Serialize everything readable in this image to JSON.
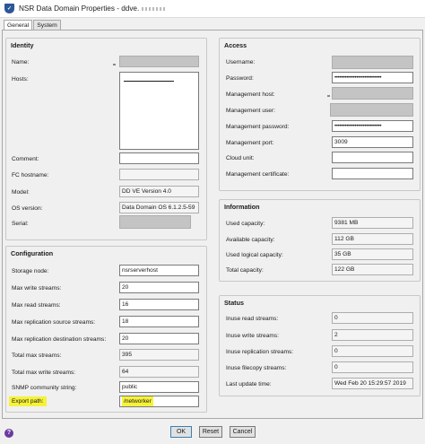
{
  "window": {
    "title": "NSR Data Domain Properties - ddve."
  },
  "tabs": [
    {
      "label": "General"
    },
    {
      "label": "System"
    }
  ],
  "identity": {
    "title": "Identity",
    "name_label": "Name:",
    "hosts_label": "Hosts:",
    "comment_label": "Comment:",
    "fc_hostname_label": "FC hostname:",
    "model_label": "Model:",
    "model_value": "DD VE Version 4.0",
    "os_version_label": "OS version:",
    "os_version_value": "Data Domain OS 6.1.2.5-59",
    "serial_label": "Serial:"
  },
  "configuration": {
    "title": "Configuration",
    "rows": [
      {
        "label": "Storage node:",
        "value": "nsrserverhost"
      },
      {
        "label": "Max write streams:",
        "value": "20"
      },
      {
        "label": "Max read streams:",
        "value": "16"
      },
      {
        "label": "Max replication source streams:",
        "value": "18"
      },
      {
        "label": "Max replication destination streams:",
        "value": "20"
      },
      {
        "label": "Total max streams:",
        "value": "395"
      },
      {
        "label": "Total max write streams:",
        "value": "64"
      },
      {
        "label": "SNMP community string:",
        "value": "public"
      }
    ],
    "export_path_label": "Export path:",
    "export_path_value": "/networker"
  },
  "access": {
    "title": "Access",
    "username_label": "Username:",
    "password_label": "Password:",
    "password_value": "••••••••••••••••••••••••••••",
    "mgmt_host_label": "Management host:",
    "mgmt_user_label": "Management user:",
    "mgmt_password_label": "Management password:",
    "mgmt_password_value": "••••••••••••••••••••••••••••",
    "mgmt_port_label": "Management port:",
    "mgmt_port_value": "3009",
    "cloud_unit_label": "Cloud unit:",
    "mgmt_cert_label": "Management certificate:"
  },
  "information": {
    "title": "Information",
    "rows": [
      {
        "label": "Used capacity:",
        "value": "9381 MB"
      },
      {
        "label": "Available capacity:",
        "value": "112 GB"
      },
      {
        "label": "Used logical capacity:",
        "value": "35 GB"
      },
      {
        "label": "Total capacity:",
        "value": "122 GB"
      }
    ]
  },
  "status": {
    "title": "Status",
    "rows": [
      {
        "label": "Inuse read streams:",
        "value": "0"
      },
      {
        "label": "Inuse write streams:",
        "value": "2"
      },
      {
        "label": "Inuse replication streams:",
        "value": "0"
      },
      {
        "label": "Inuse filecopy streams:",
        "value": "0"
      },
      {
        "label": "Last update time:",
        "value": "Wed Feb 20 15:29:57 2019"
      }
    ]
  },
  "buttons": {
    "ok": "OK",
    "reset": "Reset",
    "cancel": "Cancel"
  },
  "colors": {
    "highlight": "#f6f23a",
    "app_icon": "#2b5797",
    "help_icon": "#6a3aa0"
  }
}
